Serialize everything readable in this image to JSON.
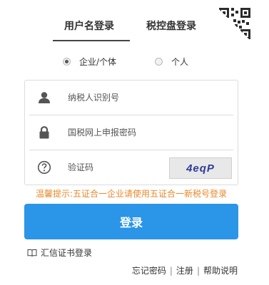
{
  "tabs": {
    "active": "用户名登录",
    "inactive": "税控盘登录"
  },
  "qr_corner_icon": "qr-code-icon",
  "taxpayer_type": {
    "options": [
      "企业/个体",
      "个人"
    ],
    "selected": "企业/个体"
  },
  "form": {
    "taxpayer_id_placeholder": "纳税人识别号",
    "password_placeholder": "国税网上申报密码",
    "captcha_placeholder": "验证码",
    "captcha_text": "4eqP",
    "icons": [
      "user-icon",
      "lock-icon",
      "help-icon"
    ]
  },
  "hint": "温馨提示:五证合一企业请使用五证合一新税号登录",
  "login_button": "登录",
  "cert_login": "汇信证书登录",
  "links": {
    "forgot_password": "忘记密码",
    "register": "注册",
    "help": "帮助说明",
    "separator": "|"
  },
  "colors": {
    "primary_button": "#2b95e8",
    "hint_text": "#e8892a",
    "captcha_text": "#2f3c9a"
  }
}
